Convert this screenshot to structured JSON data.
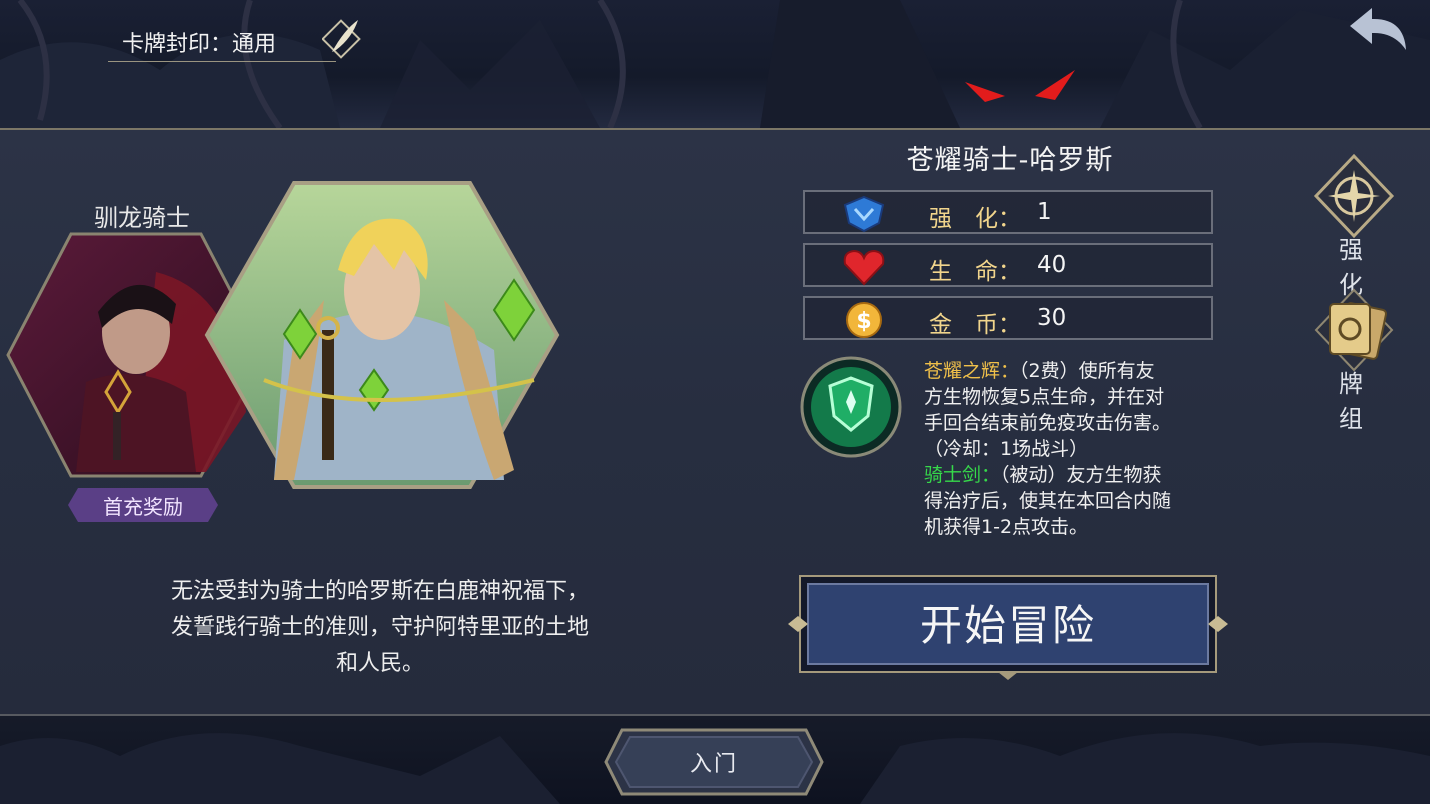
{
  "header": {
    "seal_label": "卡牌封印：通用"
  },
  "hero": {
    "name": "苍耀骑士-哈罗斯",
    "stats": [
      {
        "label": "强　化：",
        "value": "1",
        "icon": "shield-crest-icon"
      },
      {
        "label": "生　命：",
        "value": "40",
        "icon": "heart-icon"
      },
      {
        "label": "金　币：",
        "value": "30",
        "icon": "gold-coin-icon"
      }
    ],
    "skill_icon": "green-shield-skill-icon",
    "skills": [
      {
        "name": "苍耀之辉：",
        "text_lines": [
          "（2费）使所有友",
          "方生物恢复5点生命，并在对",
          "手回合结束前免疫攻击伤害。",
          "（冷却：1场战斗）"
        ],
        "color": "#f0c04a"
      },
      {
        "name": "骑士剑：",
        "text_lines": [
          "（被动）友方生物获",
          "得治疗后，使其在本回合内随",
          "机获得1-2点攻击。"
        ],
        "color": "#36d94a"
      }
    ],
    "description_lines": [
      "无法受封为骑士的哈罗斯在白鹿神祝福下，",
      "发誓践行骑士的准则，守护阿特里亚的土地",
      "和人民。"
    ]
  },
  "left_hero": {
    "name": "驯龙骑士",
    "badge": "首充奖励"
  },
  "buttons": {
    "start": "开始冒险",
    "enhance": "强化",
    "deck": "牌组",
    "rank": "入门"
  },
  "colors": {
    "accent_gold": "#f1d58c",
    "skill_gold": "#f0c04a",
    "skill_green": "#36d94a",
    "button_blue": "#2f4270"
  }
}
